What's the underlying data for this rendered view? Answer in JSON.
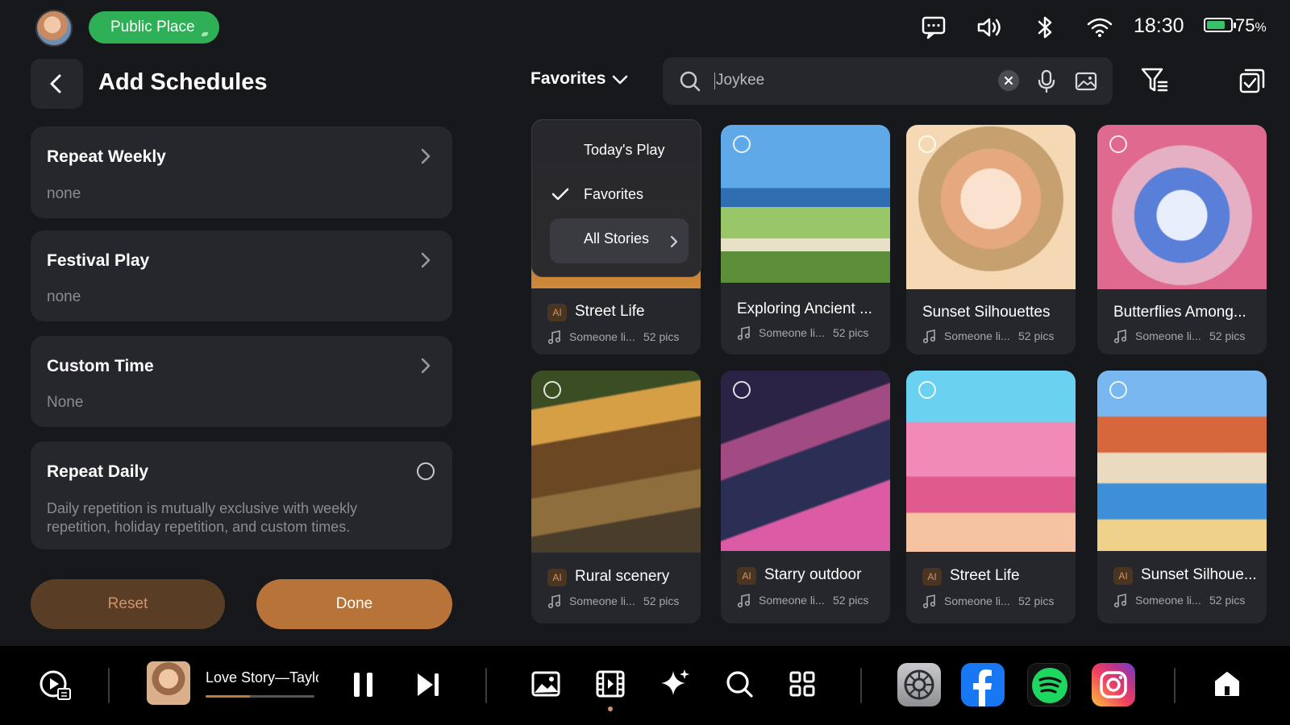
{
  "status_bar": {
    "mode": "Public Place",
    "time": "18:30",
    "battery": "75",
    "battery_unit": "%",
    "icons": [
      "avatar",
      "message-icon",
      "volume-icon",
      "bluetooth-icon",
      "wifi-icon",
      "battery-icon"
    ]
  },
  "left_panel": {
    "title": "Add Schedules",
    "items": [
      {
        "title": "Repeat Weekly",
        "value": "none"
      },
      {
        "title": "Festival Play",
        "value": "none"
      },
      {
        "title": "Custom Time",
        "value": "None"
      }
    ],
    "daily": {
      "title": "Repeat Daily",
      "description": "Daily repetition is mutually exclusive with weekly repetition, holiday repetition, and custom times."
    },
    "reset_label": "Reset",
    "done_label": "Done"
  },
  "toolbar": {
    "dropdown_label": "Favorites",
    "search_value": "Joykee",
    "search_placeholder": "Joykee"
  },
  "dropdown_menu": {
    "items": [
      "Today's Play",
      "Favorites",
      "All Stories"
    ],
    "checked": "Favorites",
    "highlighted": "All Stories"
  },
  "cards": [
    {
      "title": "Street Life",
      "ai": "AI",
      "author": "Someone li...",
      "pics": "52 pics"
    },
    {
      "title": "Exploring Ancient ...",
      "ai": "",
      "author": "Someone li...",
      "pics": "52 pics"
    },
    {
      "title": "Sunset Silhouettes",
      "ai": "",
      "author": "Someone li...",
      "pics": "52 pics"
    },
    {
      "title": "Butterflies Among...",
      "ai": "",
      "author": "Someone li...",
      "pics": "52 pics"
    },
    {
      "title": "Rural scenery",
      "ai": "AI",
      "author": "Someone li...",
      "pics": "52 pics"
    },
    {
      "title": "Starry outdoor",
      "ai": "AI",
      "author": "Someone li...",
      "pics": "52 pics"
    },
    {
      "title": "Street Life",
      "ai": "AI",
      "author": "Someone li...",
      "pics": "52 pics"
    },
    {
      "title": "Sunset Silhoue...",
      "ai": "AI",
      "author": "Someone li...",
      "pics": "52 pics"
    }
  ],
  "dock": {
    "now_playing": "Love Story—Taylor Swift",
    "progress": 0.41,
    "apps": [
      "settings-app-icon",
      "facebook-app-icon",
      "spotify-app-icon",
      "instagram-app-icon"
    ],
    "colors": {
      "accent": "#b87338",
      "green": "#2fb057"
    }
  }
}
